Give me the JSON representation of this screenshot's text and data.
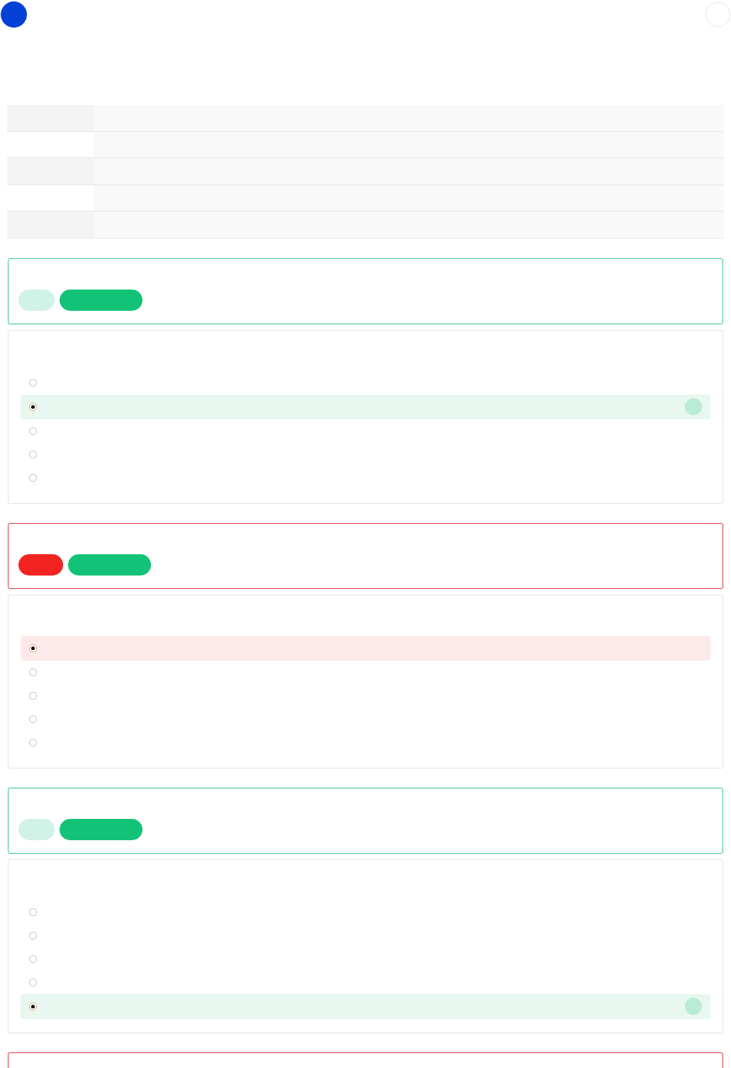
{
  "questions": [
    {
      "kind": "correct",
      "options": [
        {
          "selected": false
        },
        {
          "selected": true
        },
        {
          "selected": false
        },
        {
          "selected": false
        },
        {
          "selected": false
        }
      ]
    },
    {
      "kind": "incorrect",
      "options": [
        {
          "selected": true
        },
        {
          "selected": false
        },
        {
          "selected": false
        },
        {
          "selected": false
        },
        {
          "selected": false
        }
      ]
    },
    {
      "kind": "correct",
      "options": [
        {
          "selected": false
        },
        {
          "selected": false
        },
        {
          "selected": false
        },
        {
          "selected": false
        },
        {
          "selected": true
        }
      ]
    },
    {
      "kind": "incorrect"
    }
  ]
}
